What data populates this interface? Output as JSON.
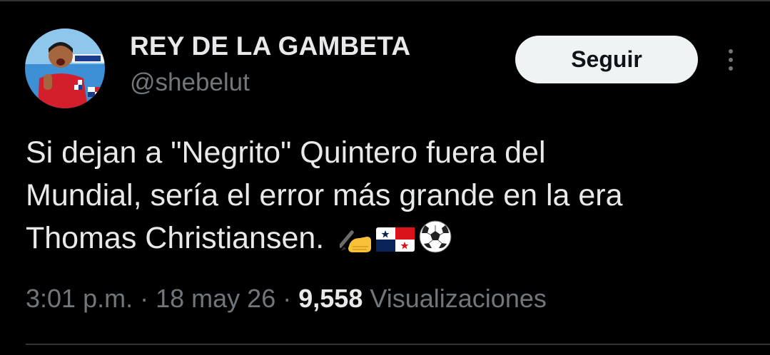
{
  "tweet": {
    "author": {
      "display_name": "REY DE LA GAMBETA",
      "handle": "@shebelut"
    },
    "follow_label": "Seguir",
    "text_lines": [
      "Si dejan a \"Negrito\" Quintero fuera del",
      "Mundial, sería el error más grande en la era",
      "Thomas Christiansen."
    ],
    "emojis": [
      "writing-hand-icon",
      "panama-flag-icon",
      "soccer-ball-icon"
    ],
    "time": "3:01 p.m.",
    "separator": "·",
    "date": "18 may 26",
    "views_count": "9,558",
    "views_label": "Visualizaciones"
  },
  "colors": {
    "background": "#000000",
    "text_primary": "#e7e9ea",
    "text_secondary": "#71767b",
    "button_bg": "#eff3f4"
  }
}
